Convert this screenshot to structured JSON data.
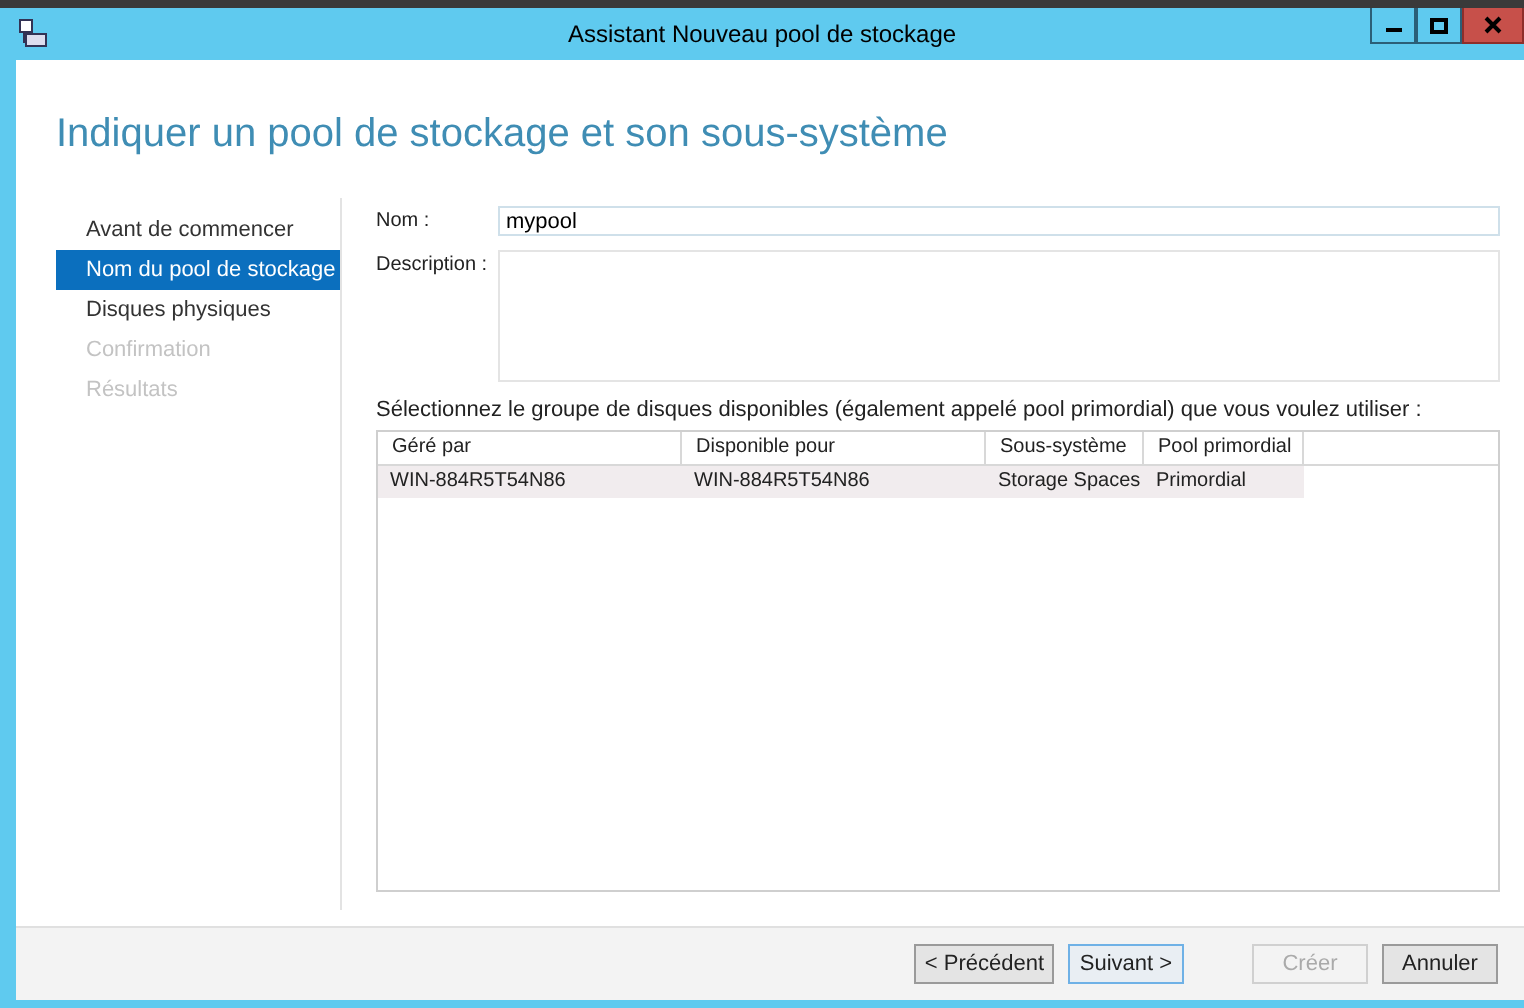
{
  "window": {
    "title": "Assistant Nouveau pool de stockage"
  },
  "heading": "Indiquer un pool de stockage et son sous-système",
  "steps": [
    {
      "label": "Avant de commencer",
      "selected": false,
      "disabled": false
    },
    {
      "label": "Nom du pool de stockage",
      "selected": true,
      "disabled": false
    },
    {
      "label": "Disques physiques",
      "selected": false,
      "disabled": false
    },
    {
      "label": "Confirmation",
      "selected": false,
      "disabled": true
    },
    {
      "label": "Résultats",
      "selected": false,
      "disabled": true
    }
  ],
  "form": {
    "name_label": "Nom :",
    "name_value": "mypool",
    "description_label": "Description :"
  },
  "table_prompt": "Sélectionnez le groupe de disques disponibles (également appelé pool primordial) que vous voulez utiliser :",
  "table": {
    "columns": [
      "Géré par",
      "Disponible pour",
      "Sous-système",
      "Pool primordial"
    ],
    "rows": [
      {
        "cells": [
          "WIN-884R5T54N86",
          "WIN-884R5T54N86",
          "Storage Spaces",
          "Primordial"
        ],
        "selected": true
      }
    ]
  },
  "buttons": [
    {
      "label": "< Précédent",
      "disabled": false,
      "focused": false
    },
    {
      "label": "Suivant >",
      "disabled": false,
      "focused": true
    },
    {
      "label": "Créer",
      "disabled": true,
      "focused": false
    },
    {
      "label": "Annuler",
      "disabled": false,
      "focused": false
    }
  ]
}
